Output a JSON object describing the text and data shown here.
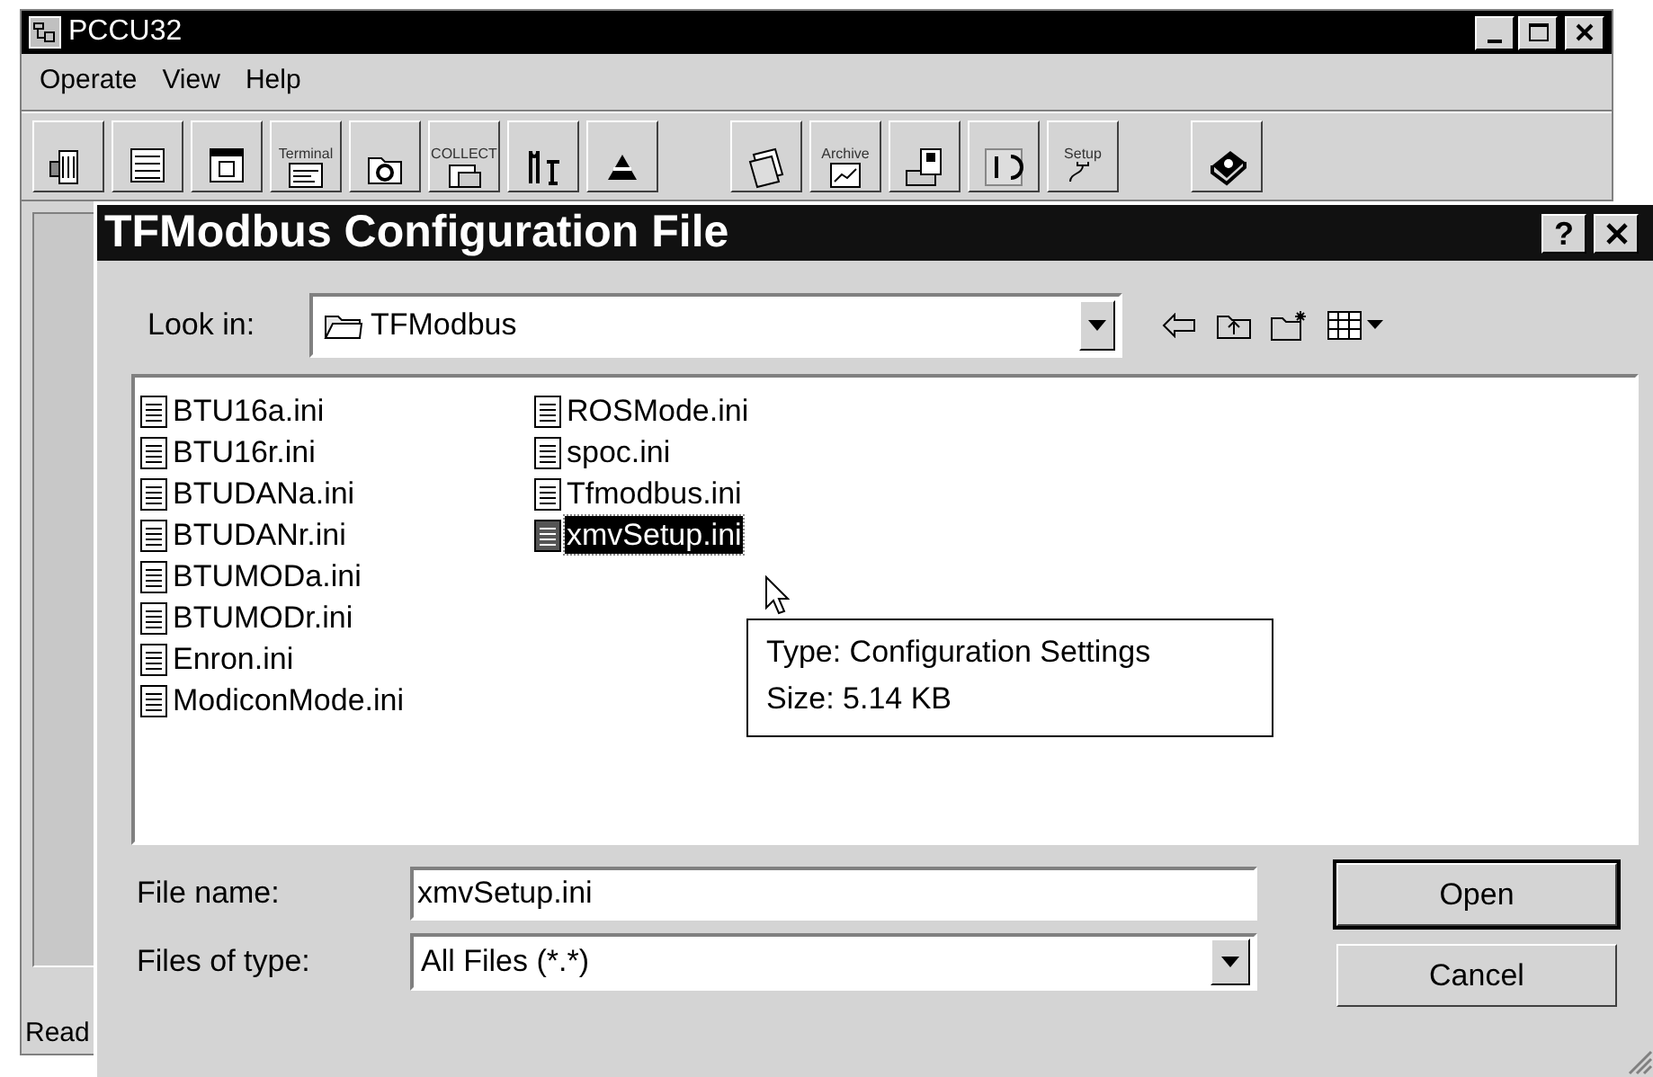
{
  "app_window": {
    "title": "PCCU32",
    "menu": [
      "Operate",
      "View",
      "Help"
    ],
    "toolbar": [
      {
        "kind": "meter"
      },
      {
        "kind": "list"
      },
      {
        "kind": "window"
      },
      {
        "kind": "terminal",
        "caption": "Terminal"
      },
      {
        "kind": "refresh"
      },
      {
        "kind": "collect",
        "caption": "COLLECT"
      },
      {
        "kind": "tools"
      },
      {
        "kind": "hat"
      },
      {
        "kind": "pages"
      },
      {
        "kind": "archive",
        "caption": "Archive"
      },
      {
        "kind": "disk"
      },
      {
        "kind": "display"
      },
      {
        "kind": "setup",
        "caption": "Setup"
      },
      {
        "kind": "book"
      }
    ],
    "status": "Read"
  },
  "dialog": {
    "title": "TFModbus Configuration File",
    "help_button": "?",
    "look_in": {
      "label": "Look in:",
      "value": "TFModbus"
    },
    "files": [
      {
        "name": "BTU16a.ini",
        "selected": false
      },
      {
        "name": "BTU16r.ini",
        "selected": false
      },
      {
        "name": "BTUDANa.ini",
        "selected": false
      },
      {
        "name": "BTUDANr.ini",
        "selected": false
      },
      {
        "name": "BTUMODa.ini",
        "selected": false
      },
      {
        "name": "BTUMODr.ini",
        "selected": false
      },
      {
        "name": "Enron.ini",
        "selected": false
      },
      {
        "name": "ModiconMode.ini",
        "selected": false
      },
      {
        "name": "ROSMode.ini",
        "selected": false
      },
      {
        "name": "spoc.ini",
        "selected": false
      },
      {
        "name": "Tfmodbus.ini",
        "selected": false
      },
      {
        "name": "xmvSetup.ini",
        "selected": true
      }
    ],
    "tooltip": [
      "Type: Configuration Settings",
      "Size: 5.14 KB"
    ],
    "file_name": {
      "label": "File name:",
      "value": "xmvSetup.ini"
    },
    "files_of_type": {
      "label": "Files of type:",
      "value": "All Files (*.*)"
    },
    "buttons": [
      {
        "label": "Open",
        "default": true
      },
      {
        "label": "Cancel",
        "default": false
      }
    ]
  }
}
